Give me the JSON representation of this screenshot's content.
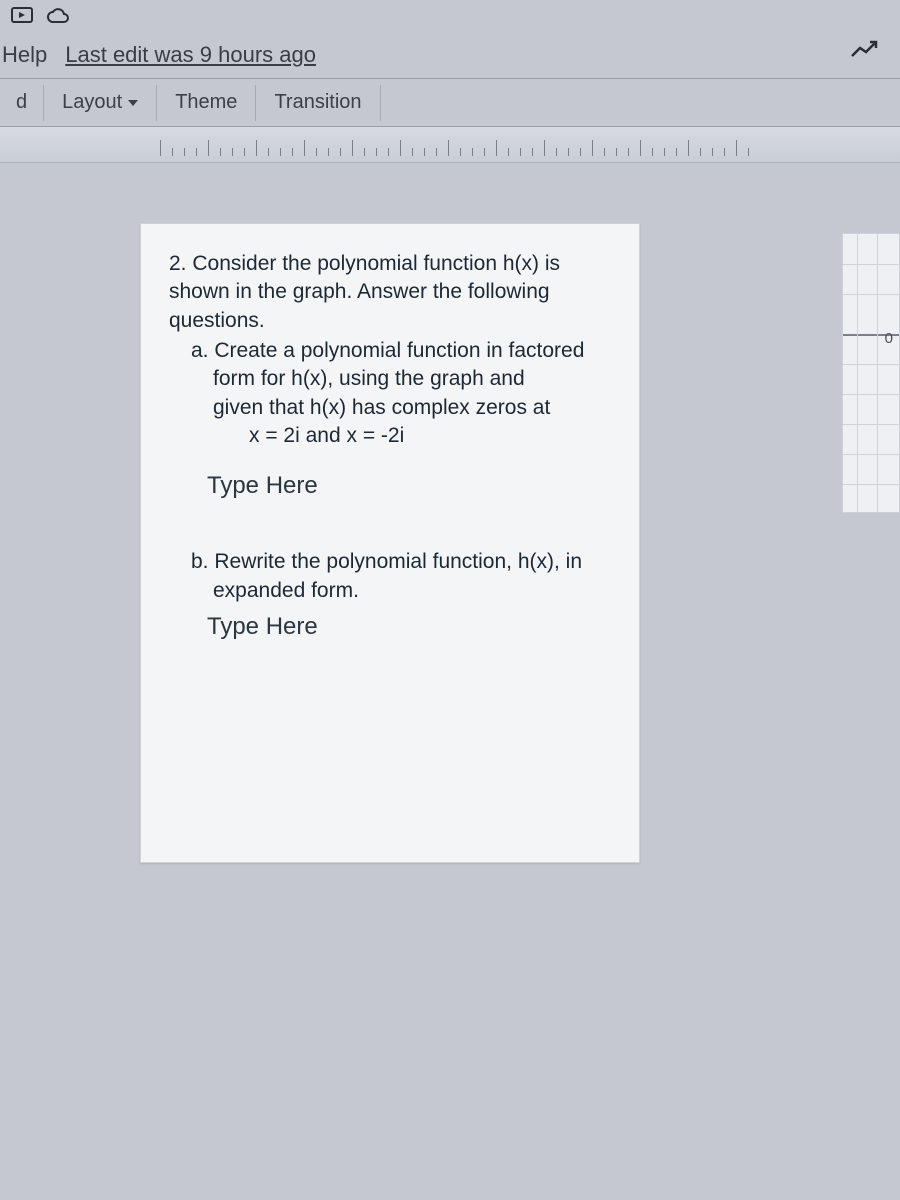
{
  "header": {
    "help_label": "Help",
    "edit_status": "Last edit was 9 hours ago"
  },
  "toolbar": {
    "left_fragment": "d",
    "layout_label": "Layout",
    "theme_label": "Theme",
    "transition_label": "Transition"
  },
  "slide": {
    "q_intro": "2. Consider the polynomial function h(x) is shown in the graph. Answer the following questions.",
    "part_a_line1": "a. Create a polynomial function in factored",
    "part_a_line2": "form for h(x), using the graph and",
    "part_a_line3": "given that h(x) has complex zeros at",
    "part_a_line4": "x = 2i and x = -2i",
    "type_here_a": "Type Here",
    "part_b_line1": "b. Rewrite the polynomial function, h(x), in",
    "part_b_line2": "expanded form.",
    "type_here_b": "Type Here",
    "graph_label_zero": "0"
  }
}
